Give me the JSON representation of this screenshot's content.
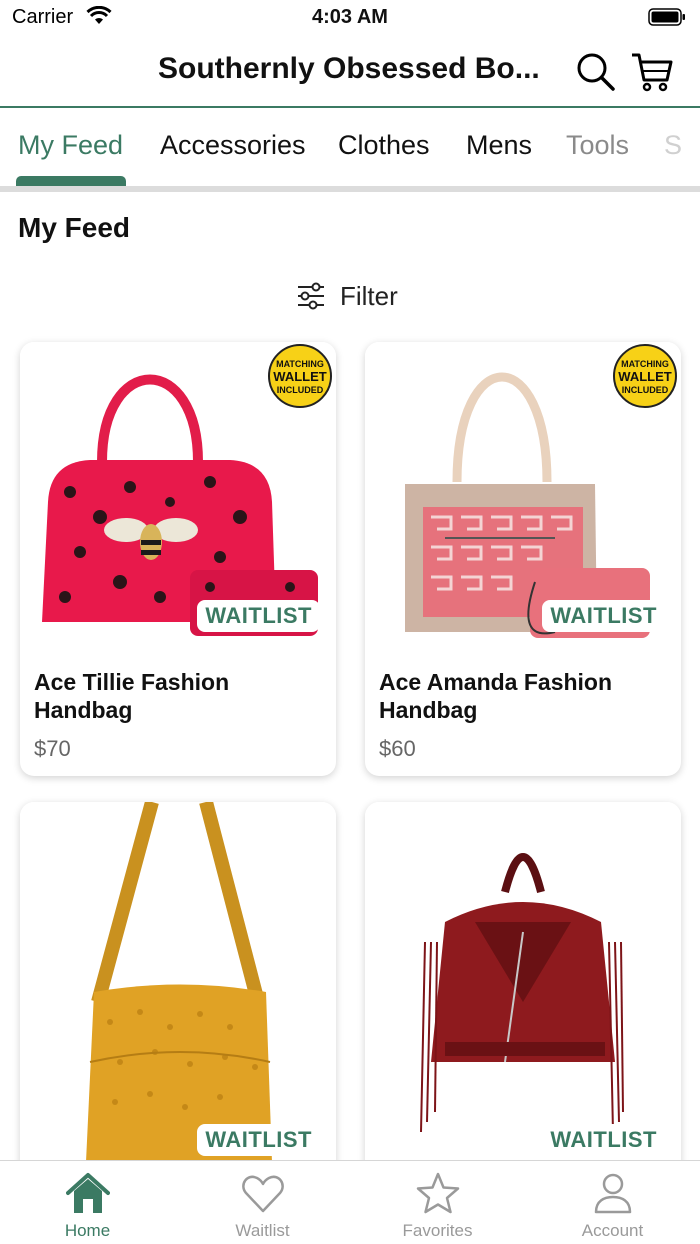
{
  "status_bar": {
    "carrier": "Carrier",
    "time": "4:03 AM"
  },
  "header": {
    "title": "Southernly Obsessed Bo..."
  },
  "tabs": [
    {
      "label": "My Feed"
    },
    {
      "label": "Accessories"
    },
    {
      "label": "Clothes"
    },
    {
      "label": "Mens"
    },
    {
      "label": "Tools"
    },
    {
      "label": "S"
    }
  ],
  "section": {
    "title": "My Feed"
  },
  "filter": {
    "label": "Filter"
  },
  "products": [
    {
      "name": "Ace Tillie Fashion Handbag",
      "price": "$70",
      "badge": "WAITLIST",
      "promo": [
        "MATCHING",
        "WALLET",
        "INCLUDED"
      ]
    },
    {
      "name": "Ace Amanda Fashion Handbag",
      "price": "$60",
      "badge": "WAITLIST",
      "promo": [
        "MATCHING",
        "WALLET",
        "INCLUDED"
      ]
    },
    {
      "name": "",
      "price": "",
      "badge": "WAITLIST"
    },
    {
      "name": "",
      "price": "",
      "badge": "WAITLIST"
    }
  ],
  "bottom_nav": [
    {
      "label": "Home",
      "icon": "home-icon"
    },
    {
      "label": "Waitlist",
      "icon": "heart-icon"
    },
    {
      "label": "Favorites",
      "icon": "star-icon"
    },
    {
      "label": "Account",
      "icon": "person-icon"
    }
  ],
  "colors": {
    "accent": "#3b7a63",
    "inactive": "#9a9a9a"
  }
}
